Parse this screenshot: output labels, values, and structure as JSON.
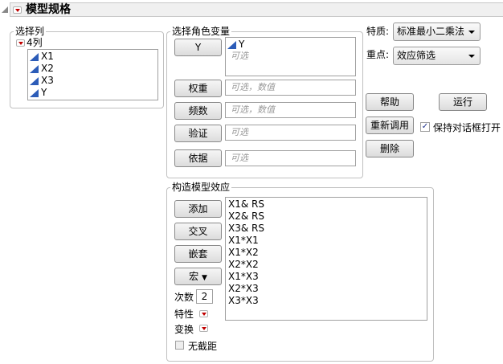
{
  "header": {
    "title": "模型规格"
  },
  "select_columns": {
    "label": "选择列",
    "group_name": "4列",
    "columns": [
      "X1",
      "X2",
      "X3",
      "Y"
    ]
  },
  "roles": {
    "label": "选择角色变量",
    "y_button": "Y",
    "y_values": [
      "Y"
    ],
    "y_placeholder": "可选",
    "weight_button": "权重",
    "weight_placeholder": "可选，数值",
    "freq_button": "频数",
    "freq_placeholder": "可选，数值",
    "validation_button": "验证",
    "validation_placeholder": "可选",
    "by_button": "依据",
    "by_placeholder": "可选"
  },
  "options": {
    "personality_label": "特质:",
    "personality_value": "标准最小二乘法",
    "emphasis_label": "重点:",
    "emphasis_value": "效应筛选"
  },
  "actions": {
    "help": "帮助",
    "run": "运行",
    "recall": "重新调用",
    "remove": "删除",
    "keep_open_label": "保持对话框打开",
    "keep_open_checked": true
  },
  "effects": {
    "label": "构造模型效应",
    "add": "添加",
    "cross": "交叉",
    "nest": "嵌套",
    "macros": "宏",
    "degree_label": "次数",
    "degree_value": "2",
    "attributes_label": "特性",
    "transform_label": "变换",
    "no_intercept_label": "无截距",
    "no_intercept_checked": false,
    "list": [
      "X1& RS",
      "X2& RS",
      "X3& RS",
      "X1*X1",
      "X1*X2",
      "X2*X2",
      "X1*X3",
      "X2*X3",
      "X3*X3"
    ]
  }
}
